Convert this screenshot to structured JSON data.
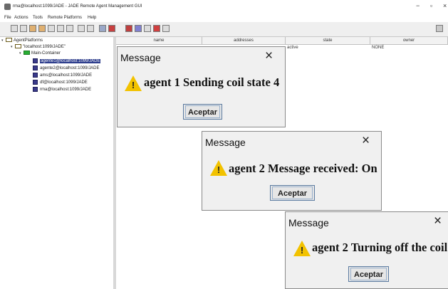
{
  "window": {
    "title": "rma@localhost:1099/JADE - JADE Remote Agent Management GUI",
    "minimize_glyph": "−",
    "maximize_glyph": "▫",
    "close_glyph": "×"
  },
  "menu": [
    "File",
    "Actions",
    "Tools",
    "Remote Platforms",
    "Help"
  ],
  "tree": {
    "root": "AgentPlatforms",
    "platform": "\"localhost:1099/JADE\"",
    "container": "Main-Container",
    "agents": [
      "agente1@localhost:1099/JADE",
      "agente2@localhost:1099/JADE",
      "ams@localhost:1099/JADE",
      "df@localhost:1099/JADE",
      "rma@localhost:1099/JADE"
    ],
    "selected_index": 0
  },
  "table": {
    "columns": [
      "name",
      "addresses",
      "state",
      "owner"
    ],
    "row": {
      "state": "active",
      "owner": "NONE"
    }
  },
  "dialogs": [
    {
      "title": "Message",
      "message": "agent 1 Sending coil state 4",
      "button": "Aceptar",
      "close": "×"
    },
    {
      "title": "Message",
      "message": "agent 2 Message received: On",
      "button": "Aceptar",
      "close": "×"
    },
    {
      "title": "Message",
      "message": "agent 2 Turning off the coil",
      "button": "Aceptar",
      "close": "×"
    }
  ],
  "icons": {
    "warning": "warning-triangle-icon",
    "warning_mark": "!",
    "expand": "▾",
    "colors": {
      "warning": "#f2c200",
      "selection": "#2b3b8b",
      "container_folder": "#27ae33"
    }
  }
}
